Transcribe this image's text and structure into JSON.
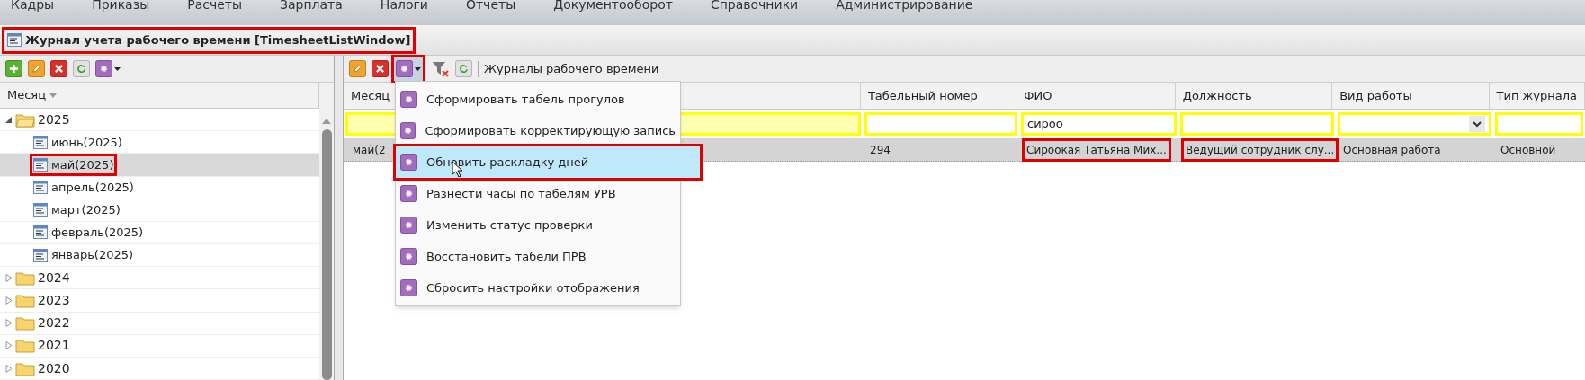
{
  "menu_bar": [
    "Кадры",
    "Приказы",
    "Расчеты",
    "Зарплата",
    "Налоги",
    "Отчеты",
    "Документооборот",
    "Справочники",
    "Администрирование"
  ],
  "window": {
    "title": "Журнал учета рабочего времени [TimesheetListWindow]",
    "annotated": true
  },
  "tree": {
    "header": "Месяц",
    "items": [
      {
        "label": "2025",
        "expanded": true,
        "children": [
          {
            "label": "июнь(2025)",
            "selected": false,
            "annotated": false
          },
          {
            "label": "май(2025)",
            "selected": true,
            "annotated": true
          },
          {
            "label": "апрель(2025)",
            "selected": false,
            "annotated": false
          },
          {
            "label": "март(2025)",
            "selected": false,
            "annotated": false
          },
          {
            "label": "февраль(2025)",
            "selected": false,
            "annotated": false
          },
          {
            "label": "январь(2025)",
            "selected": false,
            "annotated": false
          }
        ]
      },
      {
        "label": "2024",
        "expanded": false
      },
      {
        "label": "2023",
        "expanded": false
      },
      {
        "label": "2022",
        "expanded": false
      },
      {
        "label": "2021",
        "expanded": false
      },
      {
        "label": "2020",
        "expanded": false
      }
    ]
  },
  "grid_toolbar": {
    "title": "Журналы рабочего времени",
    "actions_button": {
      "pressed": true,
      "annotated": true
    }
  },
  "table": {
    "columns": [
      {
        "label": "Месяц"
      },
      {
        "label": "Табельный номер"
      },
      {
        "label": "ФИО"
      },
      {
        "label": "Должность"
      },
      {
        "label": "Вид работы"
      },
      {
        "label": "Тип журнала"
      }
    ],
    "filters": [
      {
        "kind": "month"
      },
      {
        "kind": "text"
      },
      {
        "kind": "text",
        "value": "сироо"
      },
      {
        "kind": "text"
      },
      {
        "kind": "combo"
      },
      {
        "kind": "text"
      }
    ],
    "rows": [
      {
        "selected": true,
        "cells": [
          {
            "text": "май(2",
            "annotated": false
          },
          {
            "text": "294",
            "annotated": false
          },
          {
            "text": "Сироокая Татьяна Мих...",
            "annotated": true
          },
          {
            "text": "Ведущий сотрудник слу...",
            "annotated": true
          },
          {
            "text": "Основная работа",
            "annotated": false
          },
          {
            "text": "Основной",
            "annotated": false
          }
        ]
      }
    ]
  },
  "dropdown_menu": {
    "items": [
      {
        "label": "Сформировать табель прогулов",
        "selected": false,
        "annotated": false
      },
      {
        "label": "Сформировать корректирующую запись",
        "selected": false,
        "annotated": false
      },
      {
        "label": "Обновить раскладку дней",
        "selected": true,
        "annotated": true
      },
      {
        "label": "Разнести часы по табелям УРВ",
        "selected": false,
        "annotated": false
      },
      {
        "label": "Изменить статус проверки",
        "selected": false,
        "annotated": false
      },
      {
        "label": "Восстановить табели ПРВ",
        "selected": false,
        "annotated": false
      },
      {
        "label": "Сбросить настройки отображения",
        "selected": false,
        "annotated": false
      }
    ]
  }
}
